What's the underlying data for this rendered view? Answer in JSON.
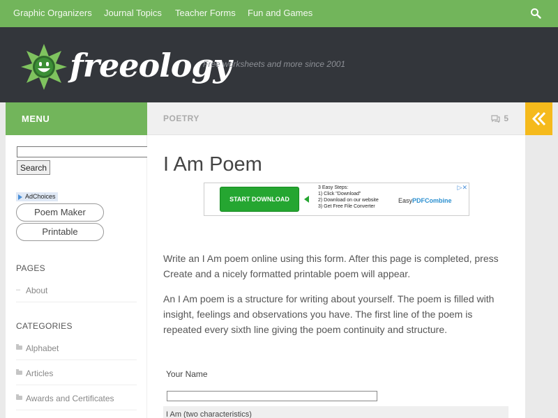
{
  "nav": {
    "items": [
      "Graphic Organizers",
      "Journal Topics",
      "Teacher Forms",
      "Fun and Games"
    ],
    "search_icon": "search-icon"
  },
  "header": {
    "logo_text": "freeology",
    "tagline": "Free worksheets and more since 2001"
  },
  "bar": {
    "menu_label": "MENU",
    "category": "POETRY",
    "comment_count": "5",
    "toggle_icon": "double-chevron-left-icon"
  },
  "sidebar": {
    "search_button": "Search",
    "adchoices": "AdChoices",
    "buttons": [
      "Poem Maker",
      "Printable"
    ],
    "pages_heading": "PAGES",
    "pages": [
      "About"
    ],
    "categories_heading": "CATEGORIES",
    "categories": [
      "Alphabet",
      "Articles",
      "Awards and Certificates"
    ]
  },
  "main": {
    "title": "I Am Poem",
    "ad": {
      "button": "START DOWNLOAD",
      "steps_title": "3 Easy Steps:",
      "step1": "1) Click \"Download\"",
      "step2": "2) Download on our website",
      "step3": "3) Get Free File Converter",
      "brand_prefix": "Easy",
      "brand_name": "PDFCombine"
    },
    "para1": "Write an I Am poem online using this form. After this page is completed, press Create and a nicely formatted printable poem will appear.",
    "para2": "An I Am poem is a structure for writing about yourself. The poem is filled with insight, feelings and observations you have. The first line of the poem is repeated every sixth line giving the poem continuity and structure.",
    "field1_label": "Your Name",
    "field2_label": "I Am (two characteristics)"
  },
  "colors": {
    "green": "#72b55b",
    "dark": "#33363b",
    "yellow": "#f5ba1c"
  }
}
